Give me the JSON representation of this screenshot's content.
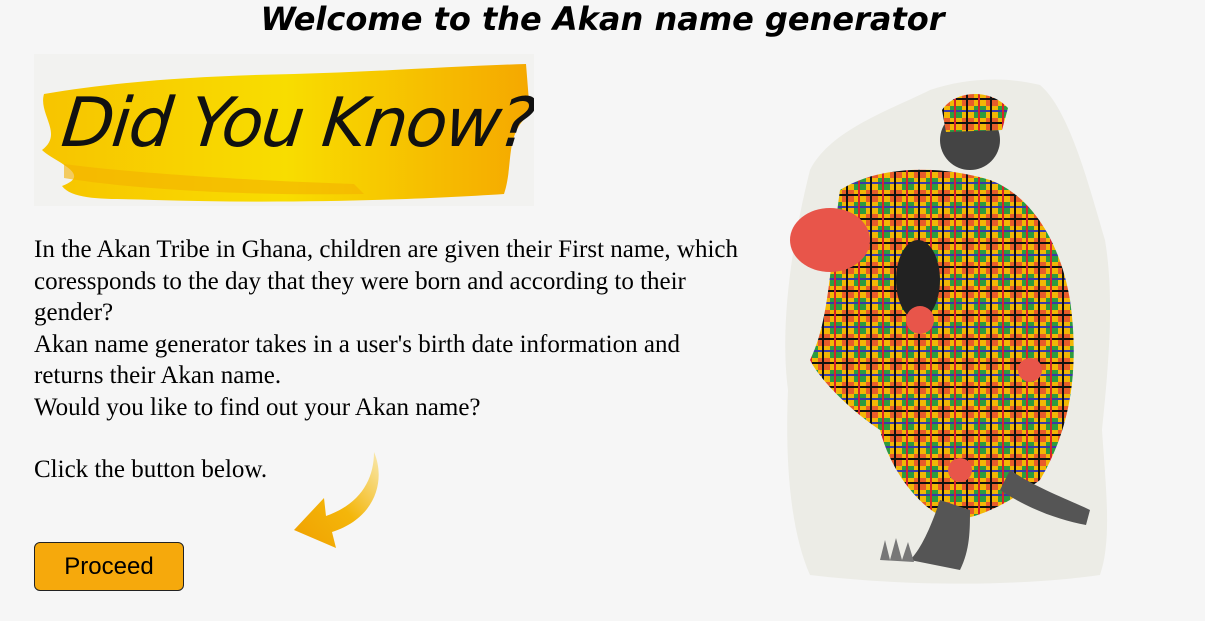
{
  "page": {
    "title": "Welcome to the Akan name generator"
  },
  "banner": {
    "text": "Did You Know?"
  },
  "intro": {
    "line1": "In the Akan Tribe in Ghana, children are given their First name, which coressponds to the day that they were born and according to their gender?",
    "line2": "Akan name generator takes in a user's birth date information and returns their Akan name.",
    "line3": "Would you like to find out your Akan name?",
    "line4": "Click the button below."
  },
  "actions": {
    "proceed_label": "Proceed"
  },
  "colors": {
    "accent": "#f6a90c",
    "banner_yellow": "#f7d000",
    "background": "#f6f6f6"
  },
  "icons": {
    "arrow": "curved-arrow-icon"
  }
}
